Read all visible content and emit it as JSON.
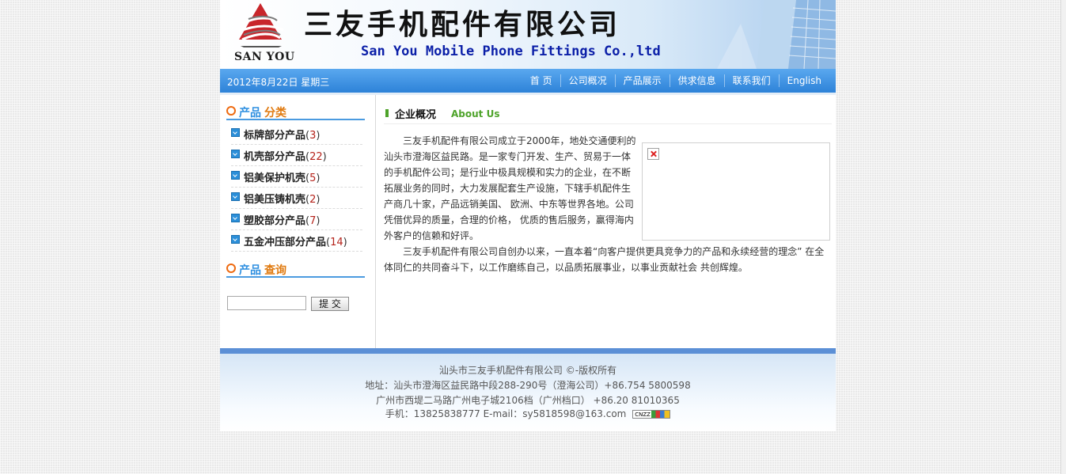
{
  "banner": {
    "logo_text": "SAN YOU",
    "cn_title": "三友手机配件有限公司",
    "en_title": "San You Mobile Phone Fittings Co.,ltd"
  },
  "nav": {
    "date": "2012年8月22日 星期三",
    "items": [
      "首 页",
      "公司概况",
      "产品展示",
      "供求信息",
      "联系我们",
      "English"
    ]
  },
  "sidebar": {
    "categories_title_a": "产品",
    "categories_title_b": "分类",
    "categories": [
      {
        "label": "标牌部分产品",
        "count": "3"
      },
      {
        "label": "机壳部分产品",
        "count": "22"
      },
      {
        "label": "铝美保护机壳",
        "count": "5"
      },
      {
        "label": "铝美压铸机壳",
        "count": "2"
      },
      {
        "label": "塑胶部分产品",
        "count": "7"
      },
      {
        "label": "五金冲压部分产品",
        "count": "14"
      }
    ],
    "search_title_a": "产品",
    "search_title_b": "查询",
    "search_value": "",
    "search_button": "提 交"
  },
  "about": {
    "title": "企业概况",
    "title_en": "About Us",
    "para1": "三友手机配件有限公司成立于2000年，地处交通便利的汕头市澄海区益民路。是一家专门开发、生产、贸易于一体的手机配件公司；是行业中极具规模和实力的企业，在不断拓展业务的同时，大力发展配套生产设施，下辖手机配件生产商几十家，产品远销美国、 欧洲、中东等世界各地。公司凭借优异的质量，合理的价格， 优质的售后服务，赢得海内外客户的信赖和好评。",
    "para2": "三友手机配件有限公司自创办以来，一直本着“向客户提供更具竞争力的产品和永续经营的理念” 在全体同仁的共同奋斗下，以工作磨练自己，以品质拓展事业，以事业贡献社会 共创辉煌。"
  },
  "footer": {
    "line1": "汕头市三友手机配件有限公司 ©-版权所有",
    "line2": "地址：汕头市澄海区益民路中段288-290号（澄海公司）+86.754 5800598",
    "line3": "广州市西堤二马路广州电子城2106档（广州档口） +86.20 81010365",
    "line4": "手机：13825838777 E-mail：sy5818598@163.com",
    "badge_text": "CNZZ"
  }
}
